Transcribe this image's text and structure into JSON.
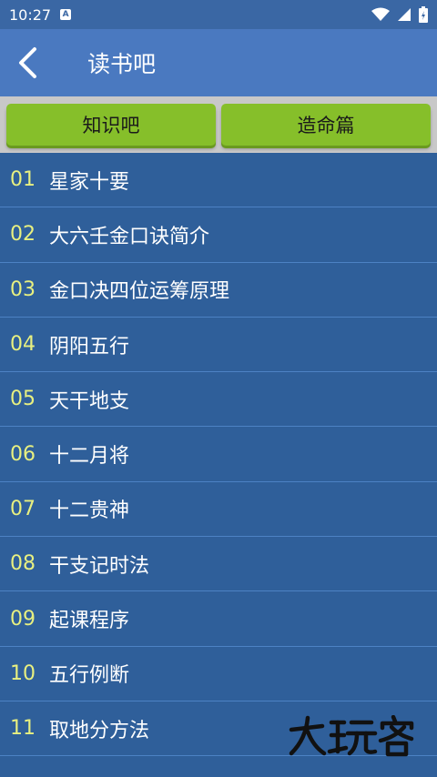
{
  "status_bar": {
    "time": "10:27",
    "badge": "A"
  },
  "toolbar": {
    "title": "读书吧"
  },
  "tabs": [
    {
      "label": "知识吧"
    },
    {
      "label": "造命篇"
    }
  ],
  "items": [
    {
      "num": "01",
      "label": "星家十要"
    },
    {
      "num": "02",
      "label": "大六壬金口诀简介"
    },
    {
      "num": "03",
      "label": "金口决四位运筹原理"
    },
    {
      "num": "04",
      "label": "阴阳五行"
    },
    {
      "num": "05",
      "label": "天干地支"
    },
    {
      "num": "06",
      "label": "十二月将"
    },
    {
      "num": "07",
      "label": "十二贵神"
    },
    {
      "num": "08",
      "label": "干支记时法"
    },
    {
      "num": "09",
      "label": "起课程序"
    },
    {
      "num": "10",
      "label": "五行例断"
    },
    {
      "num": "11",
      "label": "取地分方法"
    }
  ],
  "watermark": {
    "text": "大玩客"
  },
  "colors": {
    "status_bar": "#3a67a4",
    "toolbar": "#4a79c0",
    "tab_green": "#86bf2a",
    "list_bg": "#2f5f9a",
    "number_yellow": "#e8f080"
  }
}
